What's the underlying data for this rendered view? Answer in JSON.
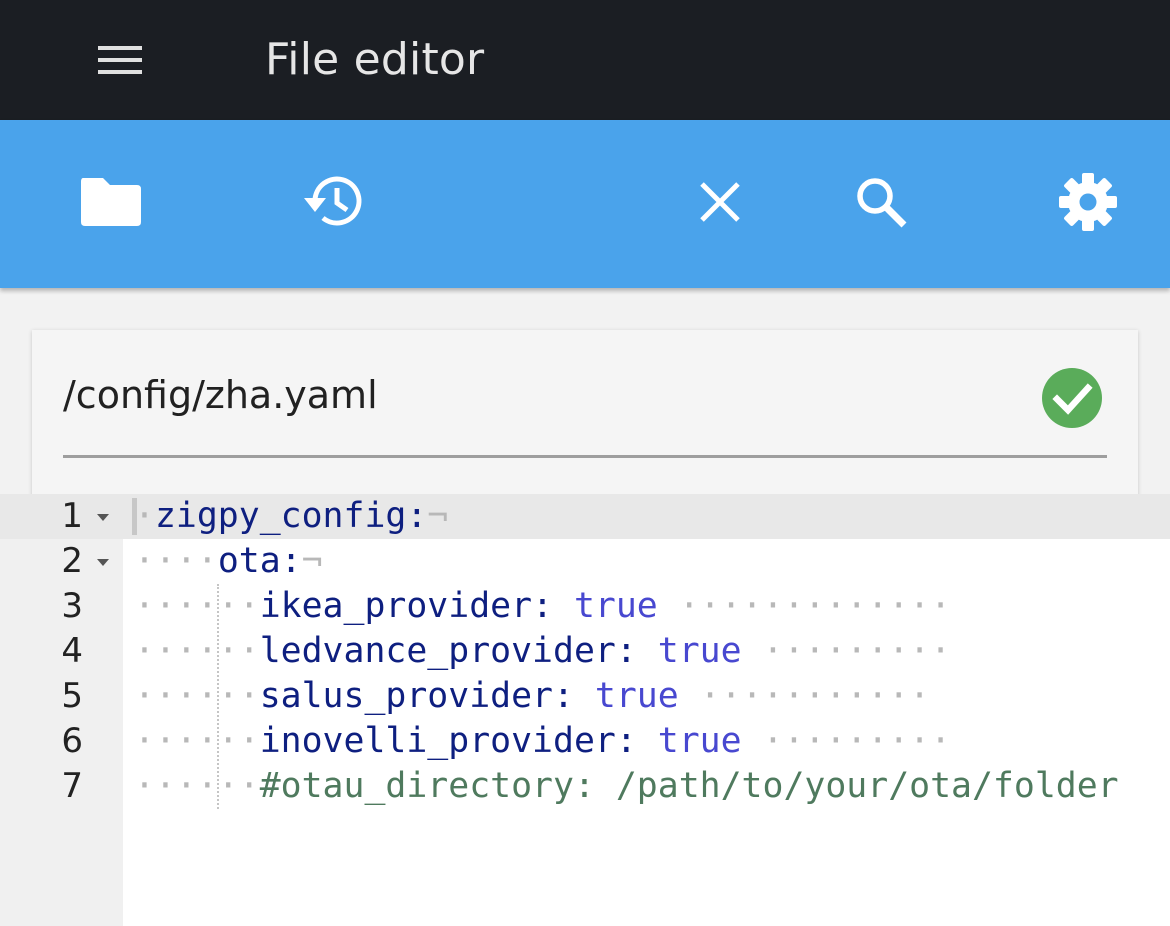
{
  "header": {
    "title": "File editor",
    "menu_icon": "menu-icon"
  },
  "toolbar": {
    "browse_icon": "folder-icon",
    "history_icon": "history-icon",
    "close_icon": "close-icon",
    "search_icon": "search-icon",
    "settings_icon": "gear-icon"
  },
  "file": {
    "path": "/config/zha.yaml",
    "status_icon": "check-circle-icon",
    "status_color": "#5aac5a"
  },
  "editor": {
    "lines": [
      {
        "number": "1",
        "indent": " ",
        "key": "zigpy_config:",
        "value": "",
        "comment": "",
        "eol": "¬",
        "trail": ""
      },
      {
        "number": "2",
        "indent": "    ",
        "key": "ota:",
        "value": "",
        "comment": "",
        "eol": "¬",
        "trail": ""
      },
      {
        "number": "3",
        "indent": "      ",
        "key": "ikea_provider:",
        "value": "true",
        "comment": "",
        "eol": "",
        "trail": " ·············"
      },
      {
        "number": "4",
        "indent": "      ",
        "key": "ledvance_provider:",
        "value": "true",
        "comment": "",
        "eol": "",
        "trail": " ·········"
      },
      {
        "number": "5",
        "indent": "      ",
        "key": "salus_provider:",
        "value": "true",
        "comment": "",
        "eol": "",
        "trail": " ···········"
      },
      {
        "number": "6",
        "indent": "      ",
        "key": "inovelli_provider:",
        "value": "true",
        "comment": "",
        "eol": "",
        "trail": " ·········"
      },
      {
        "number": "7",
        "indent": "      ",
        "key": "",
        "value": "",
        "comment": "#otau_directory: /path/to/your/ota/folder",
        "eol": "",
        "trail": ""
      }
    ]
  },
  "colors": {
    "top_bar": "#1b1e23",
    "toolbar": "#4aa3eb",
    "yaml_key": "#0e1f80",
    "yaml_value": "#4848d0",
    "yaml_comment": "#4f7a5e"
  }
}
